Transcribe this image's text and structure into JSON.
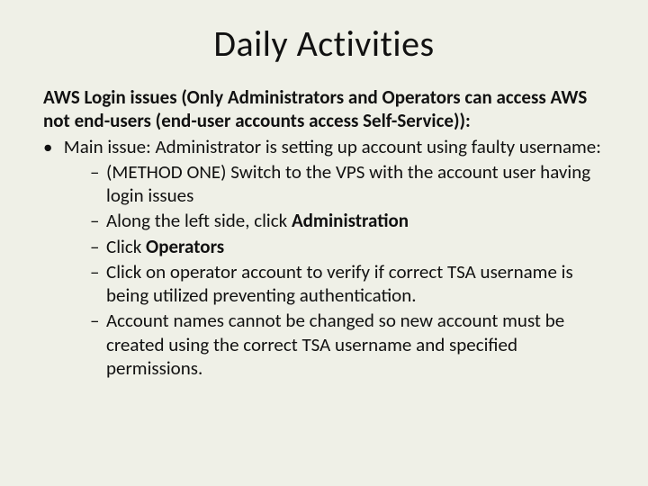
{
  "title": "Daily Activities",
  "lead": "AWS Login issues (Only Administrators and Operators can access AWS not end-users (end-user accounts access Self-Service)):",
  "main_issue": "Main issue:  Administrator is setting up account using faulty username:",
  "steps": {
    "s1": "(METHOD ONE)  Switch to the VPS with the account user having login issues",
    "s2a": "Along the left side, click ",
    "s2b": "Administration",
    "s3a": "Click ",
    "s3b": "Operators",
    "s4": "Click on operator account to verify if correct TSA username is being utilized preventing authentication.",
    "s5": "Account names cannot be changed so new account must be created using the correct TSA username and specified permissions."
  }
}
